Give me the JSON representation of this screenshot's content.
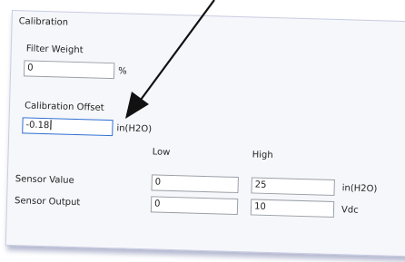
{
  "panel": {
    "title": "Calibration",
    "filter_weight": {
      "label": "Filter Weight",
      "value": "0",
      "unit": "%"
    },
    "calibration_offset": {
      "label": "Calibration Offset",
      "value": "-0.18",
      "unit": "in(H2O)"
    },
    "columns": {
      "low": "Low",
      "high": "High"
    },
    "sensor_value": {
      "label": "Sensor Value",
      "low": "0",
      "high": "25",
      "unit": "in(H2O)"
    },
    "sensor_output": {
      "label": "Sensor Output",
      "low": "0",
      "high": "10",
      "unit": "Vdc"
    }
  },
  "annotation": {
    "arrow_color": "#111111"
  }
}
